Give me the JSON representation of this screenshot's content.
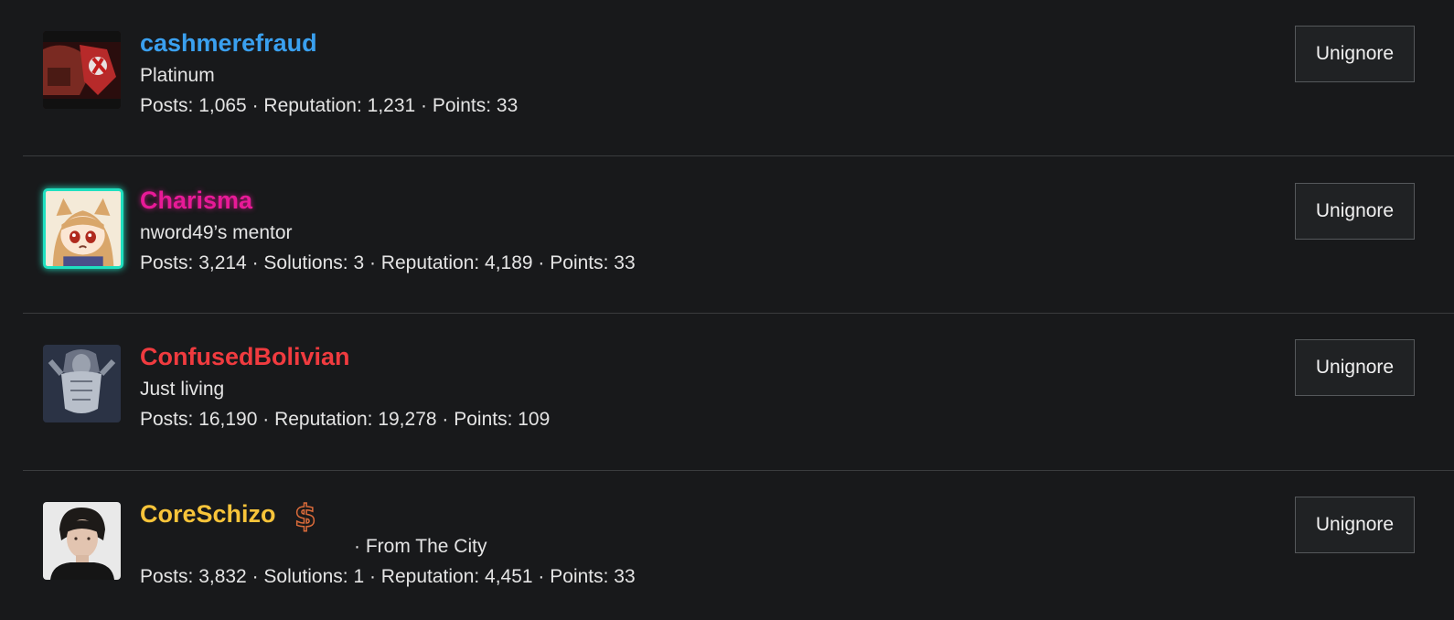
{
  "users": [
    {
      "username": "cashmerefraud",
      "title": "Platinum",
      "stats": "Posts: 1,065 · Reputation: 1,231 · Points: 33",
      "action_label": "Unignore",
      "name_color": "#3aa0ef"
    },
    {
      "username": "Charisma",
      "title": "nword49’s mentor",
      "stats": "Posts: 3,214 · Solutions: 3 · Reputation: 4,189 · Points: 33",
      "action_label": "Unignore",
      "name_color": "#e81a97",
      "avatar_border_color": "#1fe0c0"
    },
    {
      "username": "ConfusedBolivian",
      "title": "Just living",
      "stats": "Posts: 16,190 · Reputation: 19,278 · Points: 109",
      "action_label": "Unignore",
      "name_color": "#f03b3f"
    },
    {
      "username": "CoreSchizo",
      "badge": "$",
      "badge_icon": "dollar-badge-icon",
      "title": "· From The City",
      "stats": "Posts: 3,832 · Solutions: 1 · Reputation: 4,451 · Points: 33",
      "action_label": "Unignore",
      "name_color": "#f8c43a"
    }
  ]
}
